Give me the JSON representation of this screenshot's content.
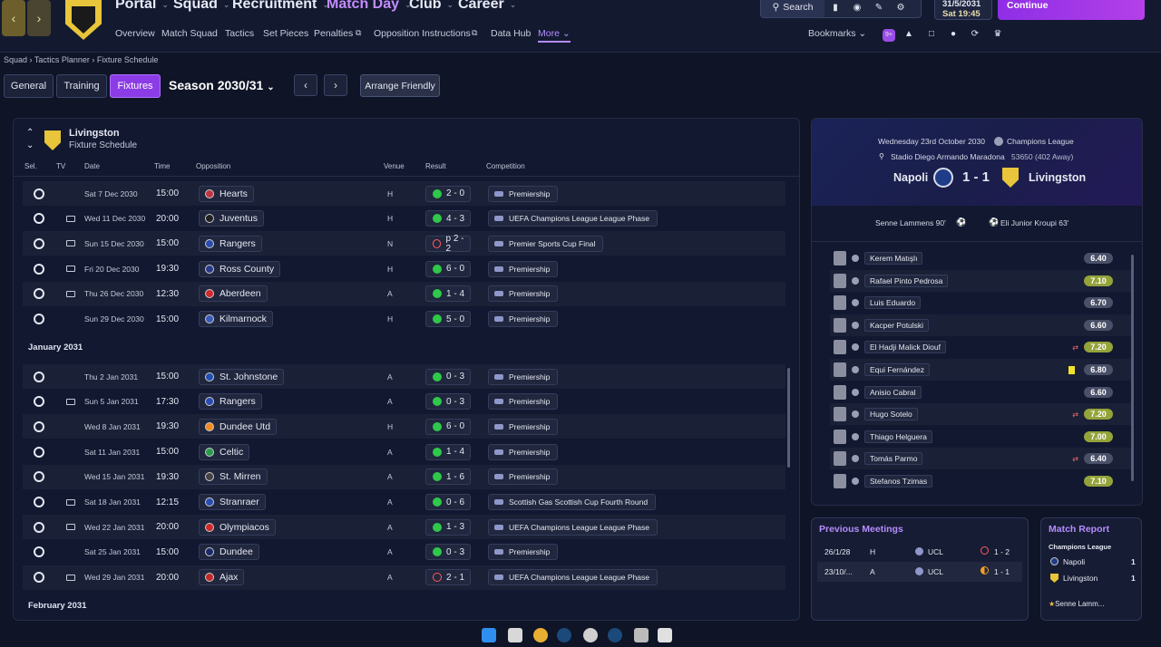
{
  "nav": {
    "menus": [
      "Portal",
      "Squad",
      "Recruitment",
      "Match Day",
      "Club",
      "Career"
    ],
    "sub": [
      "Overview",
      "Match Squad",
      "Tactics",
      "Set Pieces",
      "Penalties",
      "Opposition Instructions",
      "Data Hub",
      "More"
    ],
    "search": "Search",
    "date": "31/5/2031",
    "day_time": "Sat 19:45",
    "continue": "Continue",
    "bookmarks": "Bookmarks"
  },
  "breadcrumb": [
    "Squad",
    "Tactics Planner",
    "Fixture Schedule"
  ],
  "tabs": [
    "General",
    "Training",
    "Fixtures"
  ],
  "season": "Season 2030/31",
  "arrange": "Arrange Friendly",
  "panel": {
    "team": "Livingston",
    "subtitle": "Fixture Schedule",
    "cols": {
      "sel": "Sel.",
      "tv": "TV",
      "date": "Date",
      "time": "Time",
      "opp": "Opposition",
      "venue": "Venue",
      "result": "Result",
      "comp": "Competition"
    }
  },
  "fixtures_dec": [
    {
      "date": "Sat 7 Dec 2030",
      "time": "15:00",
      "opp": "Hearts",
      "venue": "H",
      "res": "2 - 0",
      "r": "w",
      "comp": "Premiership",
      "tv": false,
      "c": "#c0353f"
    },
    {
      "date": "Wed 11 Dec 2030",
      "time": "20:00",
      "opp": "Juventus",
      "venue": "H",
      "res": "4 - 3",
      "r": "w",
      "comp": "UEFA Champions League League Phase",
      "tv": true,
      "c": "#222"
    },
    {
      "date": "Sun 15 Dec 2030",
      "time": "15:00",
      "opp": "Rangers",
      "venue": "N",
      "res": "p 2 - 2",
      "r": "l",
      "comp": "Premier Sports Cup Final",
      "tv": true,
      "c": "#2a4bb0"
    },
    {
      "date": "Fri 20 Dec 2030",
      "time": "19:30",
      "opp": "Ross County",
      "venue": "H",
      "res": "6 - 0",
      "r": "w",
      "comp": "Premiership",
      "tv": true,
      "c": "#2a3a8a"
    },
    {
      "date": "Thu 26 Dec 2030",
      "time": "12:30",
      "opp": "Aberdeen",
      "venue": "A",
      "res": "1 - 4",
      "r": "w",
      "comp": "Premiership",
      "tv": true,
      "c": "#d02a2a"
    },
    {
      "date": "Sun 29 Dec 2030",
      "time": "15:00",
      "opp": "Kilmarnock",
      "venue": "H",
      "res": "5 - 0",
      "r": "w",
      "comp": "Premiership",
      "tv": false,
      "c": "#3a5ab8"
    }
  ],
  "month1": "January 2031",
  "fixtures_jan": [
    {
      "date": "Thu 2 Jan 2031",
      "time": "15:00",
      "opp": "St. Johnstone",
      "venue": "A",
      "res": "0 - 3",
      "r": "w",
      "comp": "Premiership",
      "tv": false,
      "c": "#2050b0"
    },
    {
      "date": "Sun 5 Jan 2031",
      "time": "17:30",
      "opp": "Rangers",
      "venue": "A",
      "res": "0 - 3",
      "r": "w",
      "comp": "Premiership",
      "tv": true,
      "c": "#2a4bb0"
    },
    {
      "date": "Wed 8 Jan 2031",
      "time": "19:30",
      "opp": "Dundee Utd",
      "venue": "H",
      "res": "6 - 0",
      "r": "w",
      "comp": "Premiership",
      "tv": false,
      "c": "#f08a20"
    },
    {
      "date": "Sat 11 Jan 2031",
      "time": "15:00",
      "opp": "Celtic",
      "venue": "A",
      "res": "1 - 4",
      "r": "w",
      "comp": "Premiership",
      "tv": false,
      "c": "#2a9a4a"
    },
    {
      "date": "Wed 15 Jan 2031",
      "time": "19:30",
      "opp": "St. Mirren",
      "venue": "A",
      "res": "1 - 6",
      "r": "w",
      "comp": "Premiership",
      "tv": false,
      "c": "#444"
    },
    {
      "date": "Sat 18 Jan 2031",
      "time": "12:15",
      "opp": "Stranraer",
      "venue": "A",
      "res": "0 - 6",
      "r": "w",
      "comp": "Scottish Gas Scottish Cup Fourth Round",
      "tv": true,
      "c": "#2a4bb0"
    },
    {
      "date": "Wed 22 Jan 2031",
      "time": "20:00",
      "opp": "Olympiacos",
      "venue": "A",
      "res": "1 - 3",
      "r": "w",
      "comp": "UEFA Champions League League Phase",
      "tv": true,
      "c": "#d02a2a"
    },
    {
      "date": "Sat 25 Jan 2031",
      "time": "15:00",
      "opp": "Dundee",
      "venue": "A",
      "res": "0 - 3",
      "r": "w",
      "comp": "Premiership",
      "tv": false,
      "c": "#1a2a6a"
    },
    {
      "date": "Wed 29 Jan 2031",
      "time": "20:00",
      "opp": "Ajax",
      "venue": "A",
      "res": "2 - 1",
      "r": "l",
      "comp": "UEFA Champions League League Phase",
      "tv": true,
      "c": "#c02a2a"
    }
  ],
  "month2": "February 2031",
  "match": {
    "date": "Wednesday 23rd October 2030",
    "comp": "Champions League",
    "stadium": "Stadio Diego Armando Maradona",
    "att": "53650 (402 Away)",
    "home": "Napoli",
    "away": "Livingston",
    "score": "1 - 1",
    "scorer_home": "Senne Lammens 90'",
    "scorer_away": "Eli Junior Kroupi 63'"
  },
  "players": [
    {
      "n": "Kerem Matışlı",
      "r": "6.40",
      "c": "g",
      "x": ""
    },
    {
      "n": "Rafael Pinto Pedrosa",
      "r": "7.10",
      "c": "y",
      "x": ""
    },
    {
      "n": "Luis Eduardo",
      "r": "6.70",
      "c": "g",
      "x": ""
    },
    {
      "n": "Kacper Potulski",
      "r": "6.60",
      "c": "g",
      "x": ""
    },
    {
      "n": "El Hadji Malick Diouf",
      "r": "7.20",
      "c": "y",
      "x": "sub"
    },
    {
      "n": "Equi Fernández",
      "r": "6.80",
      "c": "g",
      "x": "card"
    },
    {
      "n": "Anisio Cabral",
      "r": "6.60",
      "c": "g",
      "x": ""
    },
    {
      "n": "Hugo Sotelo",
      "r": "7.20",
      "c": "y",
      "x": "sub"
    },
    {
      "n": "Thiago Helguera",
      "r": "7.00",
      "c": "y",
      "x": ""
    },
    {
      "n": "Tomás Parmo",
      "r": "6.40",
      "c": "g",
      "x": "sub"
    },
    {
      "n": "Stefanos Tzimas",
      "r": "7.10",
      "c": "y",
      "x": ""
    }
  ],
  "prev": {
    "title": "Previous Meetings",
    "rows": [
      {
        "d": "26/1/28",
        "v": "H",
        "c": "UCL",
        "s": "1 - 2",
        "r": "l"
      },
      {
        "d": "23/10/...",
        "v": "A",
        "c": "UCL",
        "s": "1 - 1",
        "r": "d"
      }
    ]
  },
  "report": {
    "title": "Match Report",
    "comp": "Champions League",
    "home": "Napoli",
    "hs": "1",
    "away": "Livingston",
    "as": "1",
    "scorer": "Senne Lamm..."
  }
}
